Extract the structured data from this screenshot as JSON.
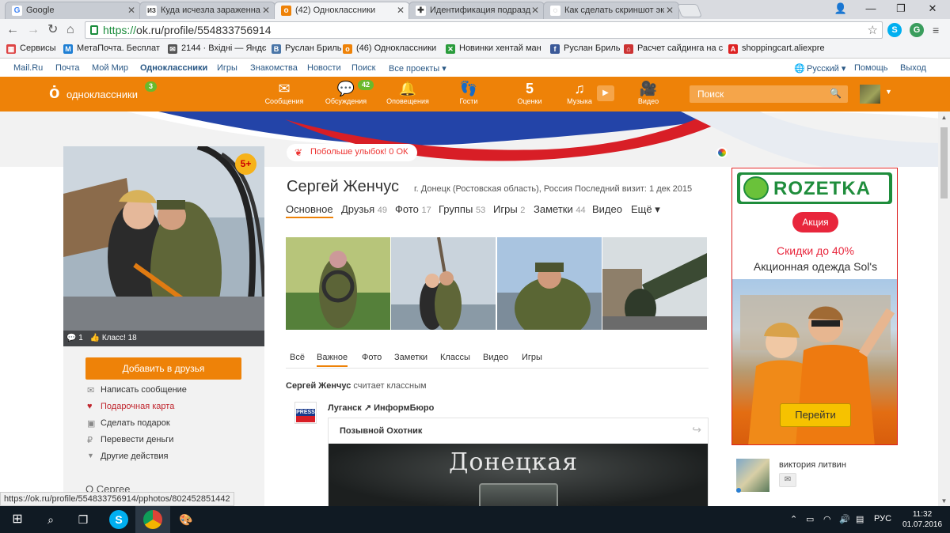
{
  "browser": {
    "tabs": [
      {
        "title": "Google",
        "favicon": "G",
        "color": "#4285f4"
      },
      {
        "title": "Куда исчезла зараженна",
        "favicon": "ИЗ",
        "color": "#333333"
      },
      {
        "title": "(42) Одноклассники",
        "favicon": "о",
        "color": "#ee8208"
      },
      {
        "title": "Идентификация подразд",
        "favicon": "✚",
        "color": "#333333"
      },
      {
        "title": "Как сделать скриншот эк",
        "favicon": "◌",
        "color": "#999999"
      }
    ],
    "url_scheme": "https://",
    "url_rest": "ok.ru/profile/554833756914",
    "bookmarks": [
      {
        "label": "Сервисы",
        "icon": "apps-icon",
        "color": "#d44"
      },
      {
        "label": "МетаПочта. Бесплат",
        "icon": "meta-icon",
        "color": "#1f7fd4"
      },
      {
        "label": "2144 · Вхідні — Яндє",
        "icon": "mail-icon",
        "color": "#555"
      },
      {
        "label": "Руслан Бриль",
        "icon": "vk-icon",
        "color": "#4a76a8"
      },
      {
        "label": "(46) Одноклассники",
        "icon": "ok-icon",
        "color": "#ee8208"
      },
      {
        "label": "Новинки хентай ман",
        "icon": "x-icon",
        "color": "#2a9c3c"
      },
      {
        "label": "Руслан Бриль",
        "icon": "facebook-icon",
        "color": "#3b5998"
      },
      {
        "label": "Расчет сайдинга на с",
        "icon": "house-icon",
        "color": "#c33"
      },
      {
        "label": "shoppingcart.aliexpre",
        "icon": "aliexpress-icon",
        "color": "#d22"
      }
    ]
  },
  "toplinks": {
    "items": [
      "Mail.Ru",
      "Почта",
      "Мой Мир",
      "Одноклассники",
      "Игры",
      "Знакомства",
      "Новости",
      "Поиск",
      "Все проекты ▾"
    ],
    "lang": "Русский ▾",
    "help": "Помощь",
    "logout": "Выход"
  },
  "okbar": {
    "logo": "одноклассники",
    "logo_badge": "3",
    "nav": [
      {
        "label": "Сообщения",
        "icon": "envelope-icon",
        "glyph": "✉"
      },
      {
        "label": "Обсуждения",
        "icon": "chat-icon",
        "glyph": "💬",
        "badge": "42"
      },
      {
        "label": "Оповещения",
        "icon": "bell-icon",
        "glyph": "🔔"
      },
      {
        "label": "Гости",
        "icon": "footprints-icon",
        "glyph": "👣"
      },
      {
        "label": "Оценки",
        "icon": "rating-icon",
        "glyph": "5"
      },
      {
        "label": "Музыка",
        "icon": "music-icon",
        "glyph": "♫"
      },
      {
        "label": "Видео",
        "icon": "camera-icon",
        "glyph": "🎥"
      }
    ],
    "search_placeholder": "Поиск"
  },
  "banner": {
    "smiles": "Побольше улыбок! 0 ОК"
  },
  "profile": {
    "name": "Сергей Женчус",
    "meta": "г. Донецк (Ростовская область), Россия Последний визит: 1 дек 2015",
    "photo_comments": "1",
    "photo_likes": "Класс! 18",
    "five_plus": "5+",
    "tabs": [
      {
        "label": "Основное",
        "count": ""
      },
      {
        "label": "Друзья",
        "count": "49"
      },
      {
        "label": "Фото",
        "count": "17"
      },
      {
        "label": "Группы",
        "count": "53"
      },
      {
        "label": "Игры",
        "count": "2"
      },
      {
        "label": "Заметки",
        "count": "44"
      },
      {
        "label": "Видео",
        "count": ""
      },
      {
        "label": "Ещё ▾",
        "count": ""
      }
    ],
    "add_friend": "Добавить в друзья",
    "actions": [
      {
        "label": "Написать сообщение",
        "icon": "envelope-icon",
        "glyph": "✉"
      },
      {
        "label": "Подарочная карта",
        "icon": "gift-card-icon",
        "glyph": "♥"
      },
      {
        "label": "Сделать подарок",
        "icon": "gift-icon",
        "glyph": "▣"
      },
      {
        "label": "Перевести деньги",
        "icon": "money-icon",
        "glyph": "₽"
      },
      {
        "label": "Другие действия",
        "icon": "triangle-down-icon",
        "glyph": "▼"
      }
    ],
    "about": "О Сергее"
  },
  "feed": {
    "tabs": [
      "Всё",
      "Важное",
      "Фото",
      "Заметки",
      "Классы",
      "Видео",
      "Игры"
    ],
    "line_name": "Сергей Женчус",
    "line_rest": "считает классным",
    "source": "Луганск ↗ ИнформБюро",
    "press": "PRESS",
    "card_title": "Позывной Охотник",
    "card_image_text": "Донецкая"
  },
  "ad": {
    "brand": "ROZETKA",
    "badge": "Акция",
    "discount": "Скидки до 40%",
    "subtitle": "Акционная одежда Sol's",
    "button": "Перейти"
  },
  "sidebar_friend": {
    "name": "виктория литвин"
  },
  "status_url": "https://ok.ru/profile/554833756914/pphotos/802452851442",
  "taskbar": {
    "lang": "РУС",
    "time": "11:32",
    "date": "01.07.2016"
  }
}
